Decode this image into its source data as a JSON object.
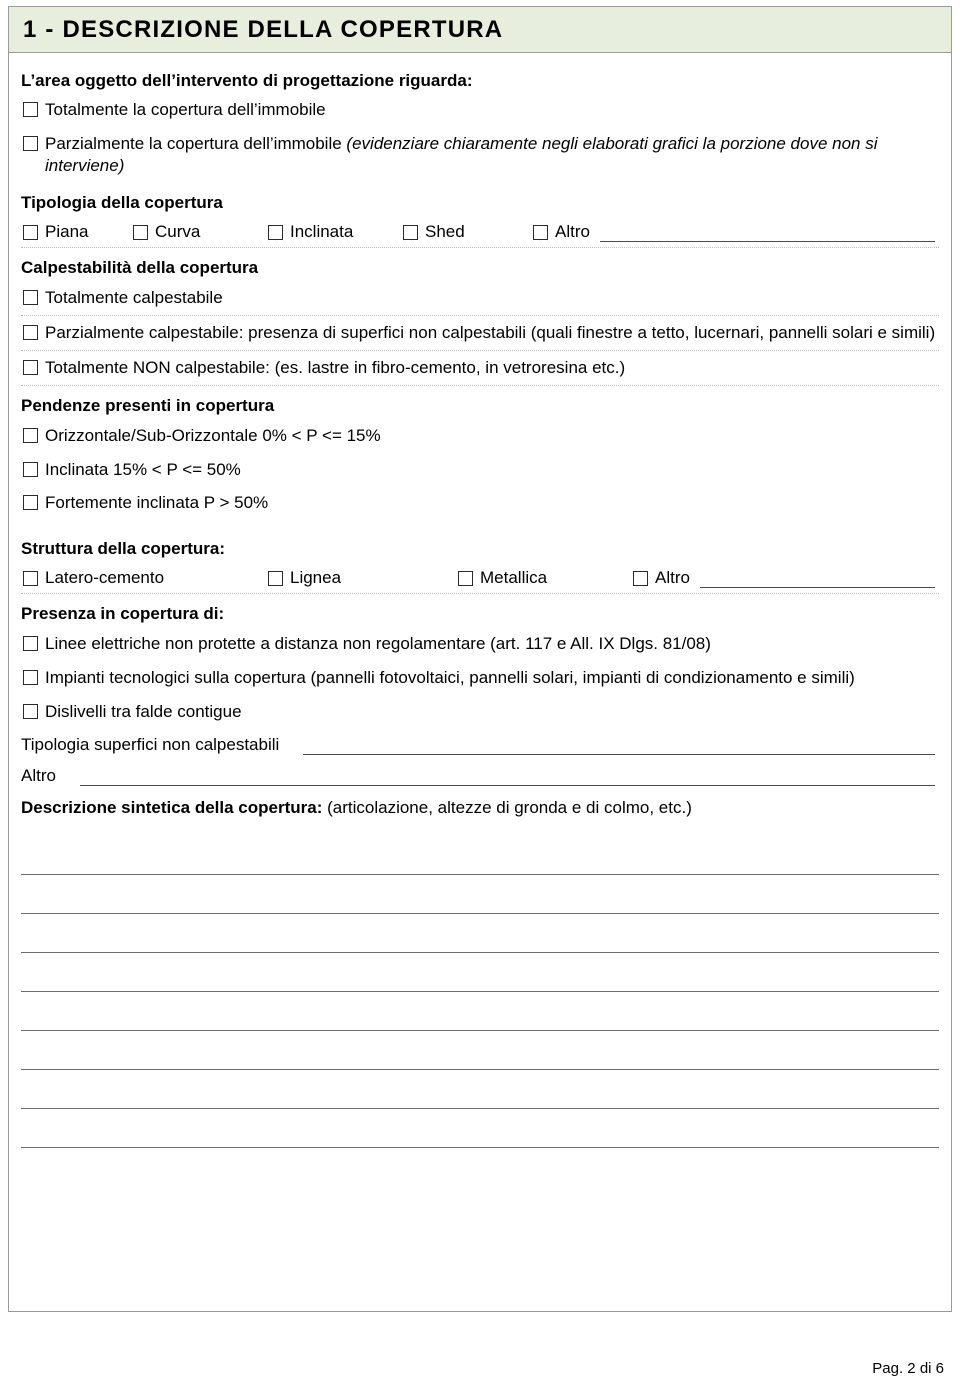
{
  "header": {
    "title": "1 - DESCRIZIONE DELLA COPERTURA"
  },
  "intro": {
    "question": "L’area oggetto dell’intervento di progettazione riguarda:"
  },
  "area_options": [
    {
      "label": "Totalmente la copertura dell’immobile",
      "italic": ""
    },
    {
      "label": "Parzialmente la copertura dell’immobile ",
      "italic": "(evidenziare chiaramente negli elaborati grafici la porzione dove non si interviene)"
    }
  ],
  "tipologia": {
    "label": "Tipologia della copertura",
    "options": [
      "Piana",
      "Curva",
      "Inclinata",
      "Shed",
      "Altro"
    ]
  },
  "calpestabilita": {
    "label": "Calpestabilità della copertura",
    "options": [
      "Totalmente calpestabile",
      "Parzialmente calpestabile: presenza di superfici non calpestabili (quali finestre a tetto, lucernari, pannelli solari e simili)",
      "Totalmente NON calpestabile: (es. lastre in fibro-cemento, in vetroresina etc.)"
    ]
  },
  "pendenze": {
    "label": "Pendenze presenti in copertura",
    "options": [
      "Orizzontale/Sub-Orizzontale   0% < P <= 15%",
      "Inclinata 15% < P <= 50%",
      "Fortemente inclinata P > 50%"
    ]
  },
  "struttura": {
    "label": "Struttura della copertura:",
    "options": [
      "Latero-cemento",
      "Lignea",
      "Metallica",
      "Altro"
    ]
  },
  "presenza": {
    "label": "Presenza in copertura di:",
    "options": [
      "Linee elettriche non protette a distanza non regolamentare (art. 117 e All. IX Dlgs. 81/08)",
      "Impianti tecnologici sulla copertura (pannelli fotovoltaici, pannelli solari, impianti di condizionamento e simili)",
      "Dislivelli tra falde contigue"
    ],
    "tipologia_superfici": "Tipologia superfici non calpestabili",
    "altro": "Altro"
  },
  "descrizione": {
    "bold": "Descrizione sintetica della copertura:",
    "rest": " (articolazione, altezze di gronda e di colmo, etc.)"
  },
  "footer": {
    "page": "Pag. 2 di 6"
  }
}
